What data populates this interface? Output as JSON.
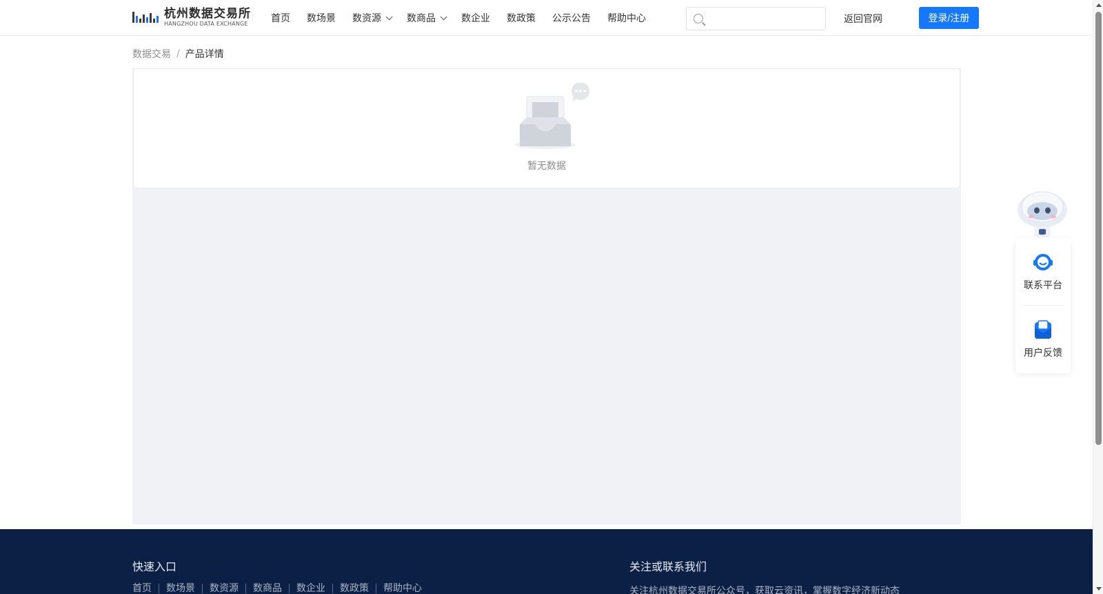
{
  "header": {
    "logo_cn": "杭州数据交易所",
    "logo_en": "HANGZHOU DATA EXCHANGE",
    "nav": [
      {
        "label": "首页",
        "has_dropdown": false
      },
      {
        "label": "数场景",
        "has_dropdown": false
      },
      {
        "label": "数资源",
        "has_dropdown": true
      },
      {
        "label": "数商品",
        "has_dropdown": true
      },
      {
        "label": "数企业",
        "has_dropdown": false
      },
      {
        "label": "数政策",
        "has_dropdown": false
      },
      {
        "label": "公示公告",
        "has_dropdown": false
      },
      {
        "label": "帮助中心",
        "has_dropdown": false
      }
    ],
    "search_placeholder": "",
    "back_link": "返回官网",
    "login_label": "登录/注册",
    "accent": "#1677ff"
  },
  "breadcrumb": {
    "parent": "数据交易",
    "separator": "/",
    "current": "产品详情"
  },
  "empty_state": {
    "text": "暂无数据",
    "icon": "empty-inbox-icon"
  },
  "side_panel": {
    "robot_icon": "assistant-robot-icon",
    "items": [
      {
        "label": "联系平台",
        "icon": "headset-icon"
      },
      {
        "label": "用户反馈",
        "icon": "mail-feedback-icon"
      }
    ]
  },
  "footer": {
    "quick_title": "快速入口",
    "quick_links": [
      "首页",
      "数场景",
      "数资源",
      "数商品",
      "数企业",
      "数政策",
      "帮助中心"
    ],
    "contact_title": "关注或联系我们",
    "contact_desc": "关注杭州数据交易所公众号，获取云资讯，掌握数字经济新动态",
    "background": "#0c2046"
  }
}
